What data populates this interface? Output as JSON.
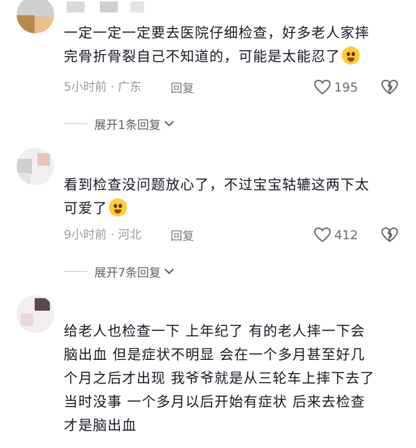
{
  "comments": [
    {
      "text_lines": [
        "一定一定一定要去医院仔细检查，好多老人家摔",
        "完骨折骨裂自己不知道的，可能是太能忍了"
      ],
      "meta": "5小时前 · 广东",
      "reply_label": "回复",
      "likes": "195",
      "expand_label": "展开1条回复",
      "emoji": "crying-face"
    },
    {
      "text_lines": [
        "看到检查没问题放心了，不过宝宝轱辘这两下太",
        "可爱了"
      ],
      "meta": "9小时前 · 河北",
      "reply_label": "回复",
      "likes": "412",
      "expand_label": "展开7条回复",
      "emoji": "laughing-face"
    },
    {
      "text_lines": [
        "给老人也检查一下  上年纪了  有的老人摔一下会",
        "脑出血  但是症状不明显  会在一个多月甚至好几",
        "个月之后才出现  我爷爷就是从三轮车上摔下去了",
        "当时没事  一个多月以后开始有症状  后来去检查",
        "才是脑出血"
      ]
    }
  ],
  "icons": {
    "like": "heart-outline-icon",
    "dislike": "broken-heart-icon",
    "expand": "chevron-down-icon"
  },
  "colors": {
    "text": "#161823",
    "meta": "#9a9aa0",
    "accent_emoji": "#ffcc33"
  }
}
